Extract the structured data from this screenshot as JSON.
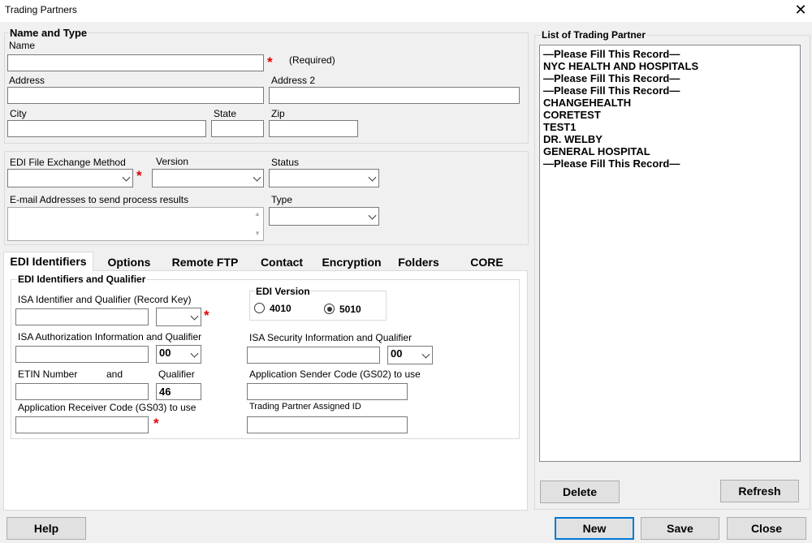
{
  "window": {
    "title": "Trading Partners"
  },
  "name_type": {
    "title": "Name and Type",
    "name_label": "Name",
    "name_value": "",
    "required_text": "(Required)",
    "address_label": "Address",
    "address2_label": "Address 2",
    "city_label": "City",
    "state_label": "State",
    "zip_label": "Zip"
  },
  "edi": {
    "method_label": "EDI File Exchange Method",
    "version_label": "Version",
    "status_label": "Status",
    "emails_label": "E-mail Addresses to send process results",
    "type_label": "Type"
  },
  "tabs": [
    {
      "label": "EDI Identifiers",
      "active": true
    },
    {
      "label": "Options"
    },
    {
      "label": "Remote FTP"
    },
    {
      "label": "Contact"
    },
    {
      "label": "Encryption"
    },
    {
      "label": "Folders"
    },
    {
      "label": "CORE"
    }
  ],
  "identifiers": {
    "group_title": "EDI Identifiers and Qualifier",
    "isa_id_label": "ISA Identifier and Qualifier (Record Key)",
    "edi_version_title": "EDI Version",
    "v4010": "4010",
    "v5010": "5010",
    "selected_version": "5010",
    "isa_auth_label": "ISA Authorization Information and Qualifier",
    "isa_auth_qual": "00",
    "isa_sec_label": "ISA Security Information and Qualifier",
    "isa_sec_qual": "00",
    "etin_label": "ETIN  Number",
    "and_label": "and",
    "qualifier_label": "Qualifier",
    "qualifier_value": "46",
    "gs02_label": "Application Sender Code (GS02) to use",
    "gs03_label": "Application Receiver Code (GS03) to use",
    "tp_id_label": "Trading Partner Assigned ID"
  },
  "partner_list": {
    "title": "List of Trading Partner",
    "items": [
      "—Please Fill This Record—",
      "NYC HEALTH AND HOSPITALS",
      "—Please Fill This Record—",
      "—Please Fill This Record—",
      "CHANGEHEALTH",
      "CORETEST",
      "TEST1",
      "DR. WELBY",
      "GENERAL HOSPITAL",
      "—Please Fill This Record—"
    ],
    "delete_label": "Delete",
    "refresh_label": "Refresh"
  },
  "footer": {
    "help_label": "Help",
    "new_label": "New",
    "save_label": "Save",
    "close_label": "Close"
  },
  "colors": {
    "required_star": "#e00000",
    "default_button_border": "#0078d7"
  }
}
